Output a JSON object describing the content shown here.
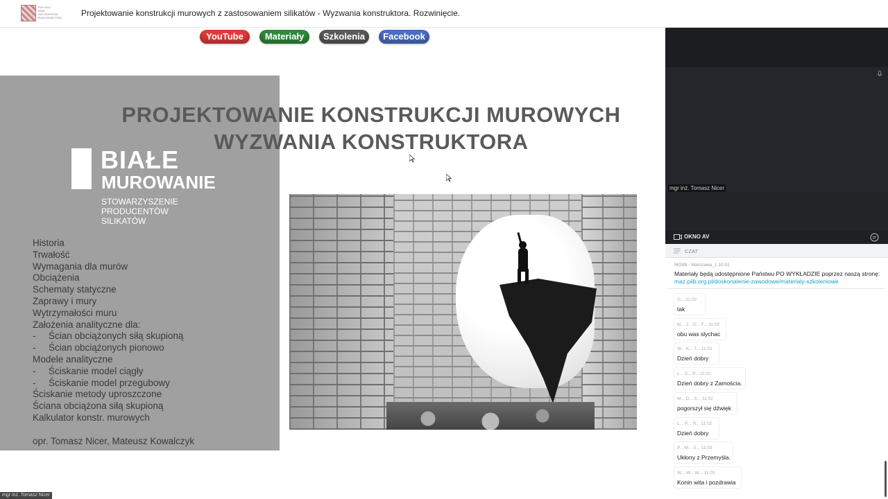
{
  "header": {
    "title": "Projektowanie konstrukcji murowych z zastosowaniem silikatów - Wyzwania konstruktora. Rozwinięcie.",
    "logo_lines": [
      "POLSKA",
      "IZBA",
      "INŻYNIERÓW",
      "BUDOWNICTWA"
    ]
  },
  "links": {
    "youtube": "YouTube",
    "materialy": "Materiały",
    "szkolenia": "Szkolenia",
    "facebook": "Facebook"
  },
  "slide": {
    "title_line1": "PROJEKTOWANIE KONSTRUKCJI MUROWYCH",
    "title_line2": "WYZWANIA KONSTRUKTORA",
    "brand_line1": "BIAŁE",
    "brand_line2": "MUROWANIE",
    "brand_sub": [
      "STOWARZYSZENIE",
      "PRODUCENTÓW",
      "SILIKATÓW"
    ],
    "toc": [
      {
        "dash": "",
        "text": "Historia"
      },
      {
        "dash": "",
        "text": "Trwałość"
      },
      {
        "dash": "",
        "text": "Wymagania dla murów"
      },
      {
        "dash": "",
        "text": "Obciążenia"
      },
      {
        "dash": "",
        "text": "Schematy statyczne"
      },
      {
        "dash": "",
        "text": "Zaprawy  i mury"
      },
      {
        "dash": "",
        "text": "Wytrzymałości muru"
      },
      {
        "dash": "",
        "text": "Założenia analityczne dla:"
      },
      {
        "dash": "-",
        "text": "Ścian obciążonych siłą skupioną"
      },
      {
        "dash": "-",
        "text": "Ścian obciążonych pionowo"
      },
      {
        "dash": "",
        "text": "Modele analityczne"
      },
      {
        "dash": "-",
        "text": "Ściskanie model ciągły"
      },
      {
        "dash": "-",
        "text": "Ściskanie model przegubowy"
      },
      {
        "dash": "",
        "text": "Ściskanie metody uproszczone"
      },
      {
        "dash": "",
        "text": "Ściana obciążona siłą skupioną"
      },
      {
        "dash": "",
        "text": "Kalkulator konstr. murowych"
      }
    ],
    "authors": "opr. Tomasz Nicer, Mateusz Kowalczyk"
  },
  "video": {
    "presenter": "mgr inż. Tomasz Nicer",
    "av_label": "OKNO AV"
  },
  "chat": {
    "header": "CZAT",
    "pinned": {
      "meta": "MOIIB - Warszawa_1    10:51",
      "text": "Materiały będą udostępnione Państwu PO WYKŁADZIE poprzez naszą stronę: ",
      "link": "maz.piib.org.pl/doskonalenie-zawodowe/materialy-szkoleniowe"
    },
    "messages": [
      {
        "meta": "G...    11:02",
        "text": "tak"
      },
      {
        "meta": "M... J... D... F...    11:02",
        "text": "obu was slychac"
      },
      {
        "meta": "W... K... T...    11:02",
        "text": "Dzień dobry"
      },
      {
        "meta": "L... S... P...    11:02",
        "text": "Dzień dobry z Zamościa."
      },
      {
        "meta": "M... D... S...    11:02",
        "text": "pogorszył się dźwięk"
      },
      {
        "meta": "L... R... R...    11:02",
        "text": "Dzień dobry"
      },
      {
        "meta": "P... M... S...    11:03",
        "text": "Ukłony z Przemyśla."
      },
      {
        "meta": "W... W... M...    11:03",
        "text": "Konin wita i pozdrawia"
      }
    ]
  },
  "footer": {
    "presenter_label": "mgr inż. Tomasz Nicer"
  }
}
